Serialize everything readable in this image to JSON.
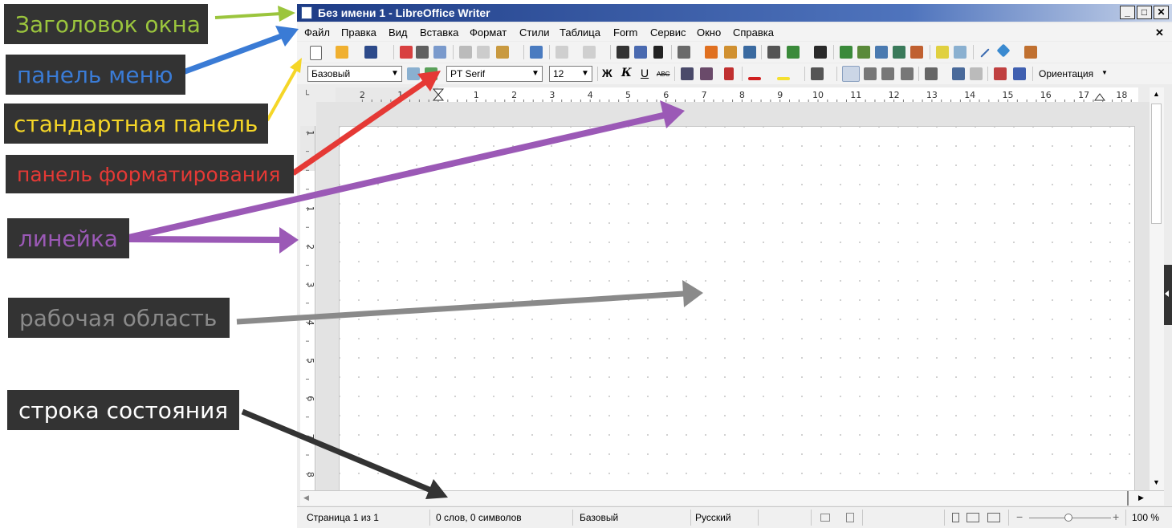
{
  "annotations": {
    "title_bar": {
      "text": "Заголовок окна",
      "color": "#9bc53d"
    },
    "menu_bar": {
      "text": "панель меню",
      "color": "#3a7bd5"
    },
    "standard_bar": {
      "text": "стандартная панель",
      "color": "#f5d627"
    },
    "format_bar": {
      "text": "панель форматирования",
      "color": "#e53935"
    },
    "ruler": {
      "text": "линейка",
      "color": "#9b59b6"
    },
    "workspace": {
      "text": "рабочая область",
      "color": "#8a8a8a"
    },
    "status_bar": {
      "text": "строка состояния",
      "color": "#ffffff"
    }
  },
  "window": {
    "title": "Без имени 1 - LibreOffice Writer",
    "minimize": "_",
    "maximize": "□",
    "close": "✕",
    "doc_close": "✕"
  },
  "menu": [
    "Файл",
    "Правка",
    "Вид",
    "Вставка",
    "Формат",
    "Стили",
    "Таблица",
    "Form",
    "Сервис",
    "Окно",
    "Справка"
  ],
  "formatting": {
    "style": "Базовый",
    "font": "PT Serif",
    "size": "12",
    "bold": "Ж",
    "italic": "К",
    "underline": "U",
    "strike": "ABC",
    "orientation": "Ориентация"
  },
  "ruler": {
    "h_labels": [
      "2",
      "1",
      "1",
      "2",
      "3",
      "4",
      "5",
      "6",
      "7",
      "8",
      "9",
      "10",
      "11",
      "12",
      "13",
      "14",
      "15",
      "16",
      "17",
      "18"
    ],
    "v_labels": [
      "1",
      "1",
      "2",
      "3",
      "4",
      "5",
      "6",
      "7",
      "8"
    ]
  },
  "status": {
    "page": "Страница 1 из 1",
    "words": "0 слов, 0 символов",
    "style": "Базовый",
    "language": "Русский",
    "zoom": "100 %",
    "zoom_minus": "−",
    "zoom_plus": "+"
  }
}
